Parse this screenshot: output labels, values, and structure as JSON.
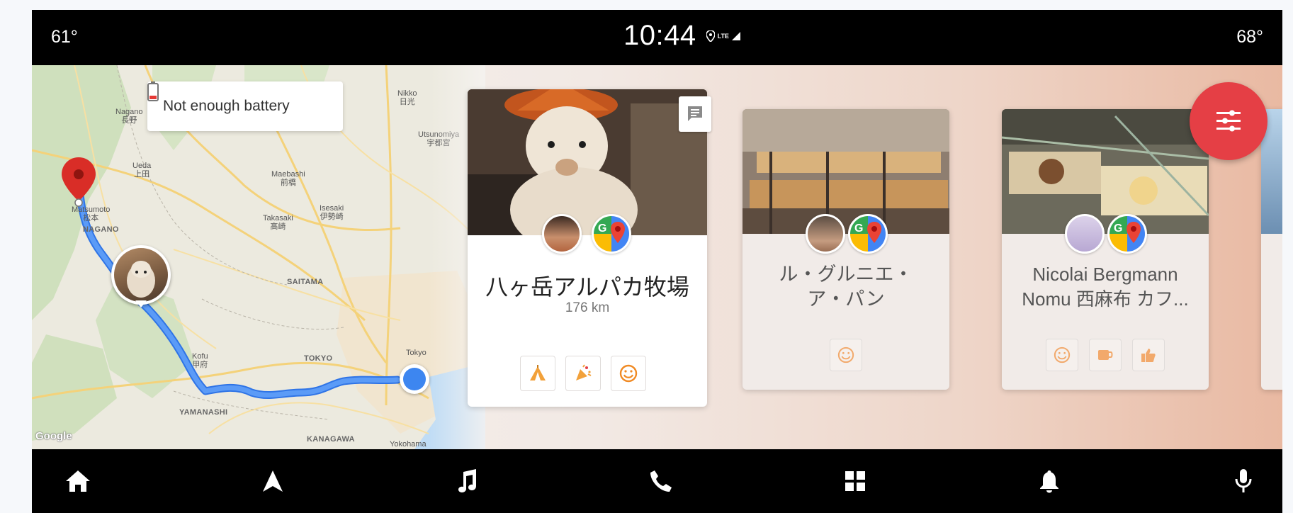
{
  "status_bar": {
    "temp_left": "61°",
    "clock": "10:44",
    "signal_label": "LTE",
    "temp_right": "68°"
  },
  "map": {
    "battery_message": "Not enough battery",
    "attribution": "Google",
    "labels": [
      {
        "id": "nagano",
        "text": "Nagano\n長野"
      },
      {
        "id": "ueda",
        "text": "Ueda\n上田"
      },
      {
        "id": "matsumoto",
        "text": "Matsumoto\n松本"
      },
      {
        "id": "nagano-pref",
        "text": "NAGANO"
      },
      {
        "id": "maebashi",
        "text": "Maebashi\n前橋"
      },
      {
        "id": "takasaki",
        "text": "Takasaki\n高崎"
      },
      {
        "id": "isesaki",
        "text": "Isesaki\n伊勢崎"
      },
      {
        "id": "saitama",
        "text": "SAITAMA"
      },
      {
        "id": "nikko",
        "text": "Nikko\n日光"
      },
      {
        "id": "utsunomiya",
        "text": "Utsunomiya\n宇都宮"
      },
      {
        "id": "kofu",
        "text": "Kofu\n甲府"
      },
      {
        "id": "tokyo-pref",
        "text": "TOKYO"
      },
      {
        "id": "tokyo",
        "text": "Tokyo"
      },
      {
        "id": "yamanashi",
        "text": "YAMANASHI"
      },
      {
        "id": "kanagawa",
        "text": "KANAGAWA"
      },
      {
        "id": "yokohama",
        "text": "Yokohama"
      }
    ]
  },
  "cards": [
    {
      "title": "八ヶ岳アルパカ牧場",
      "distance": "176 km",
      "chips": [
        "tent-icon",
        "party-popper-icon",
        "smiley-icon"
      ]
    },
    {
      "title": "ル・グルニエ・ア・パン",
      "chips": [
        "smiley-icon"
      ]
    },
    {
      "title": "Nicolai Bergmann Nomu 西麻布 カフ...",
      "chips": [
        "smiley-icon",
        "coffee-icon",
        "thumbs-up-icon"
      ]
    }
  ],
  "nav": {
    "items": [
      "home-icon",
      "navigation-icon",
      "music-icon",
      "phone-icon",
      "apps-grid-icon",
      "notifications-icon",
      "microphone-icon"
    ]
  },
  "colors": {
    "accent_red": "#e53f45",
    "route_blue": "#3d86f0"
  }
}
